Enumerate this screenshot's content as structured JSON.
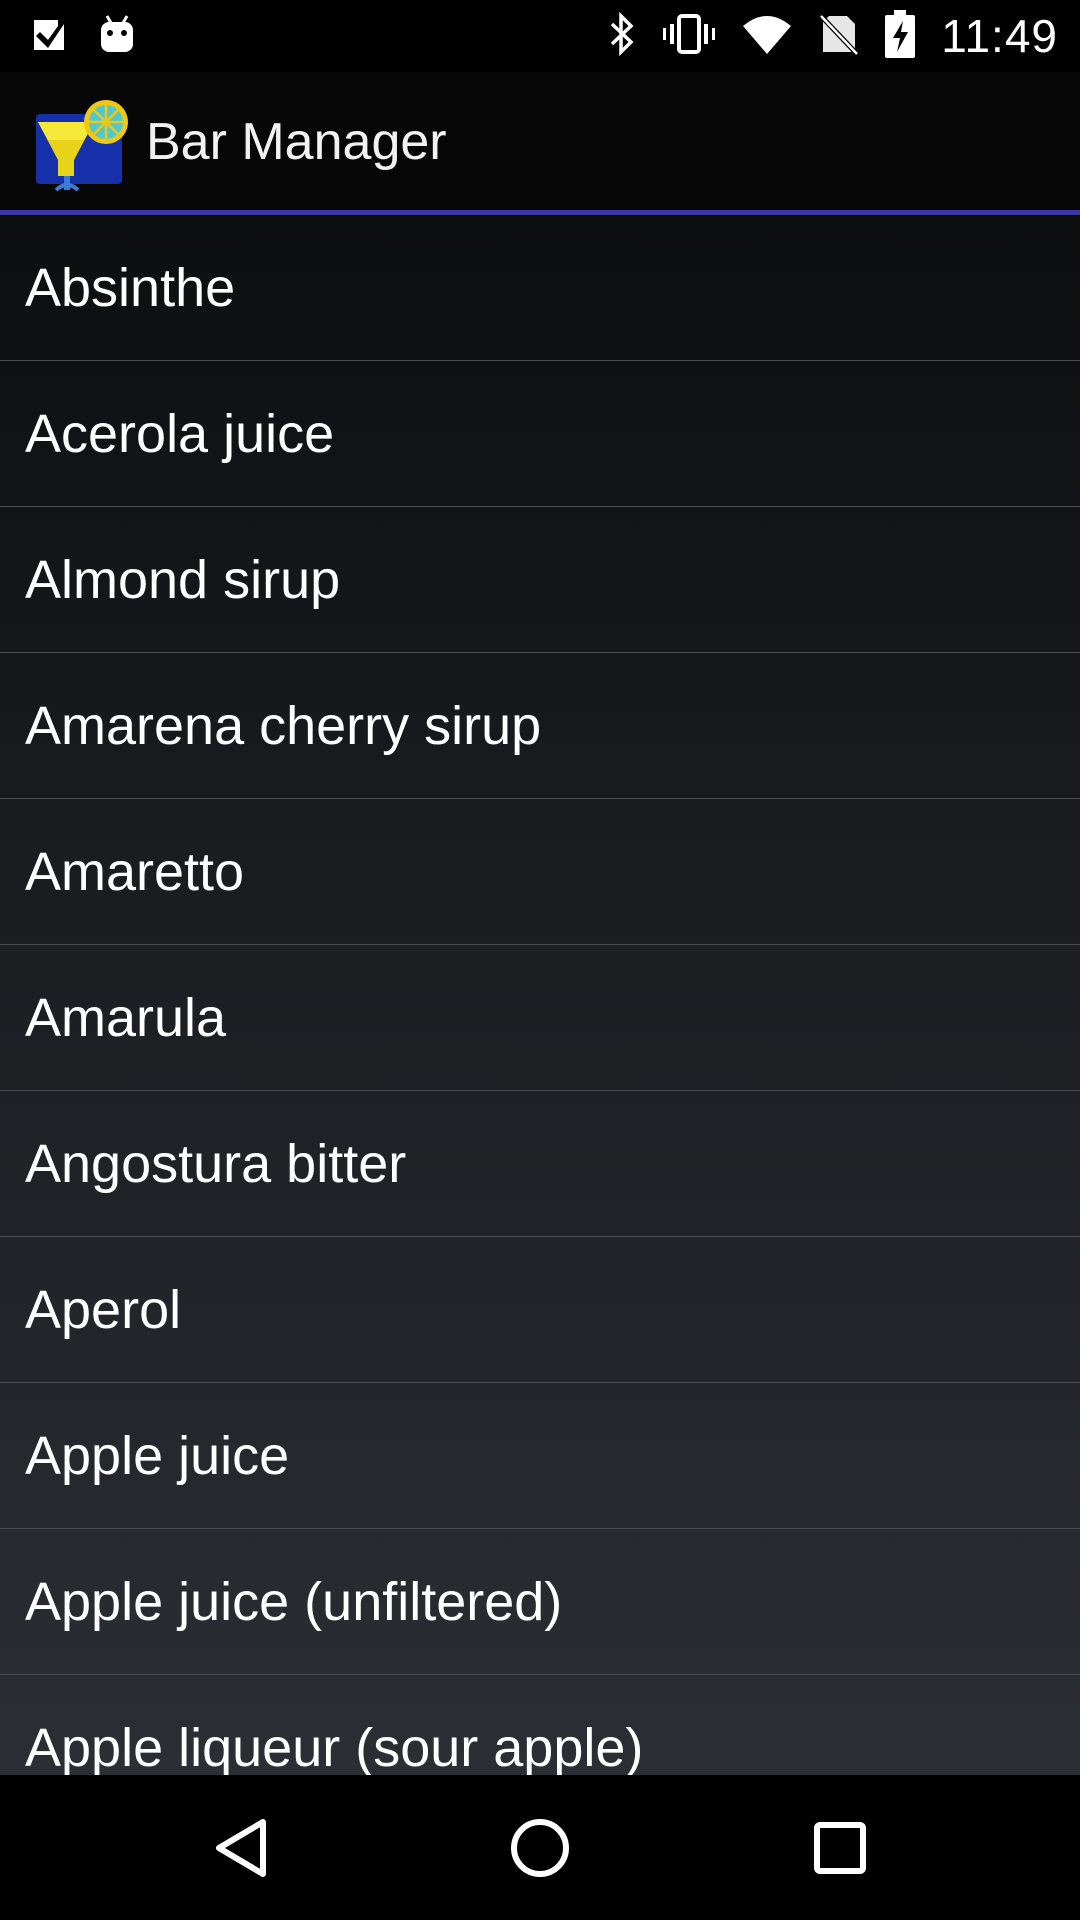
{
  "status_bar": {
    "time": "11:49",
    "left_icons": [
      "checkbox-icon",
      "android-icon"
    ],
    "right_icons": [
      "bluetooth-icon",
      "vibrate-icon",
      "wifi-icon",
      "no-sim-icon",
      "battery-charging-icon"
    ]
  },
  "app_bar": {
    "title": "Bar Manager",
    "icon": "bar-manager-logo"
  },
  "ingredients": [
    "Absinthe",
    "Acerola juice",
    "Almond sirup",
    "Amarena cherry sirup",
    "Amaretto",
    "Amarula",
    "Angostura bitter",
    "Aperol",
    "Apple juice",
    "Apple juice (unfiltered)",
    "Apple liqueur (sour apple)"
  ],
  "nav_bar": {
    "buttons": [
      "back-icon",
      "home-icon",
      "recents-icon"
    ]
  },
  "colors": {
    "accent_divider": "#3a36a6",
    "background": "#000000"
  }
}
